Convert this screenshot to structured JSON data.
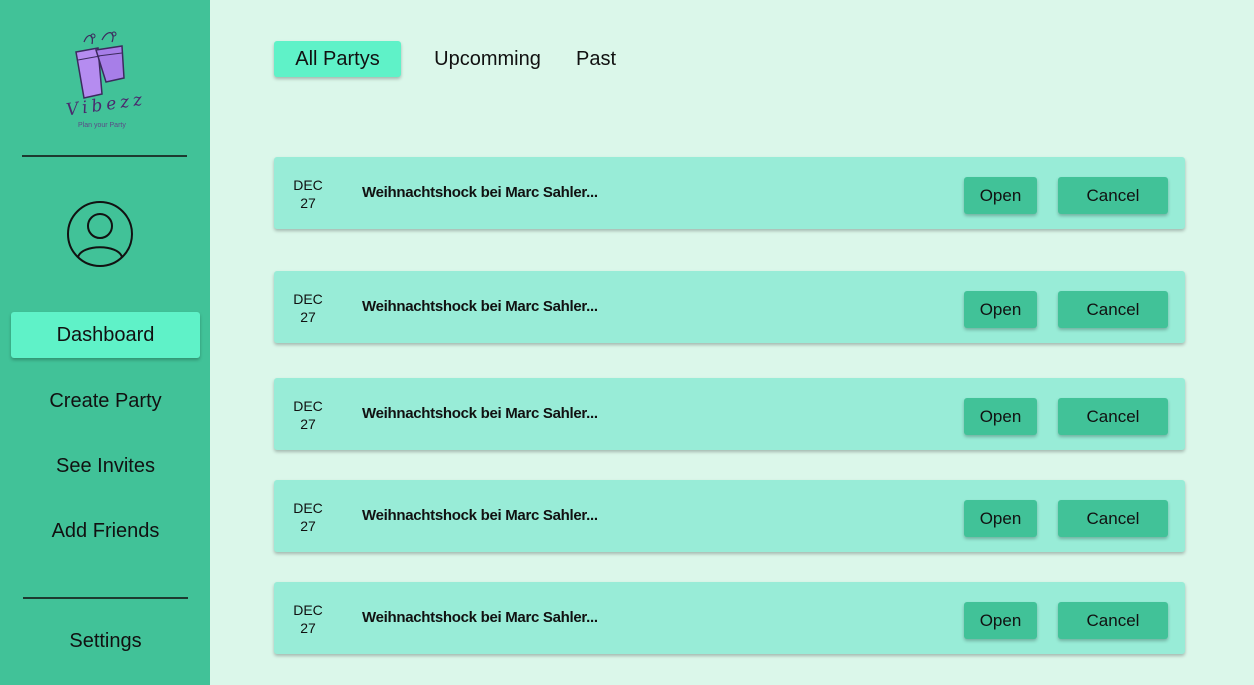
{
  "brand": {
    "name": "Vibezz",
    "tagline": "Plan your Party"
  },
  "sidebar": {
    "items": [
      {
        "label": "Dashboard",
        "active": true
      },
      {
        "label": "Create Party",
        "active": false
      },
      {
        "label": "See Invites",
        "active": false
      },
      {
        "label": "Add Friends",
        "active": false
      }
    ],
    "settings_label": "Settings"
  },
  "tabs": [
    {
      "label": "All Partys",
      "active": true
    },
    {
      "label": "Upcomming",
      "active": false
    },
    {
      "label": "Past",
      "active": false
    }
  ],
  "parties": [
    {
      "month": "DEC",
      "day": "27",
      "title": "Weihnachtshock bei Marc Sahler..."
    },
    {
      "month": "DEC",
      "day": "27",
      "title": "Weihnachtshock bei Marc Sahler..."
    },
    {
      "month": "DEC",
      "day": "27",
      "title": "Weihnachtshock bei Marc Sahler..."
    },
    {
      "month": "DEC",
      "day": "27",
      "title": "Weihnachtshock bei Marc Sahler..."
    },
    {
      "month": "DEC",
      "day": "27",
      "title": "Weihnachtshock bei Marc Sahler..."
    }
  ],
  "actions": {
    "open_label": "Open",
    "cancel_label": "Cancel"
  },
  "colors": {
    "sidebar": "#41c298",
    "background": "#dbf7ea",
    "accent": "#5ff2c8",
    "card": "#98ecd7"
  }
}
